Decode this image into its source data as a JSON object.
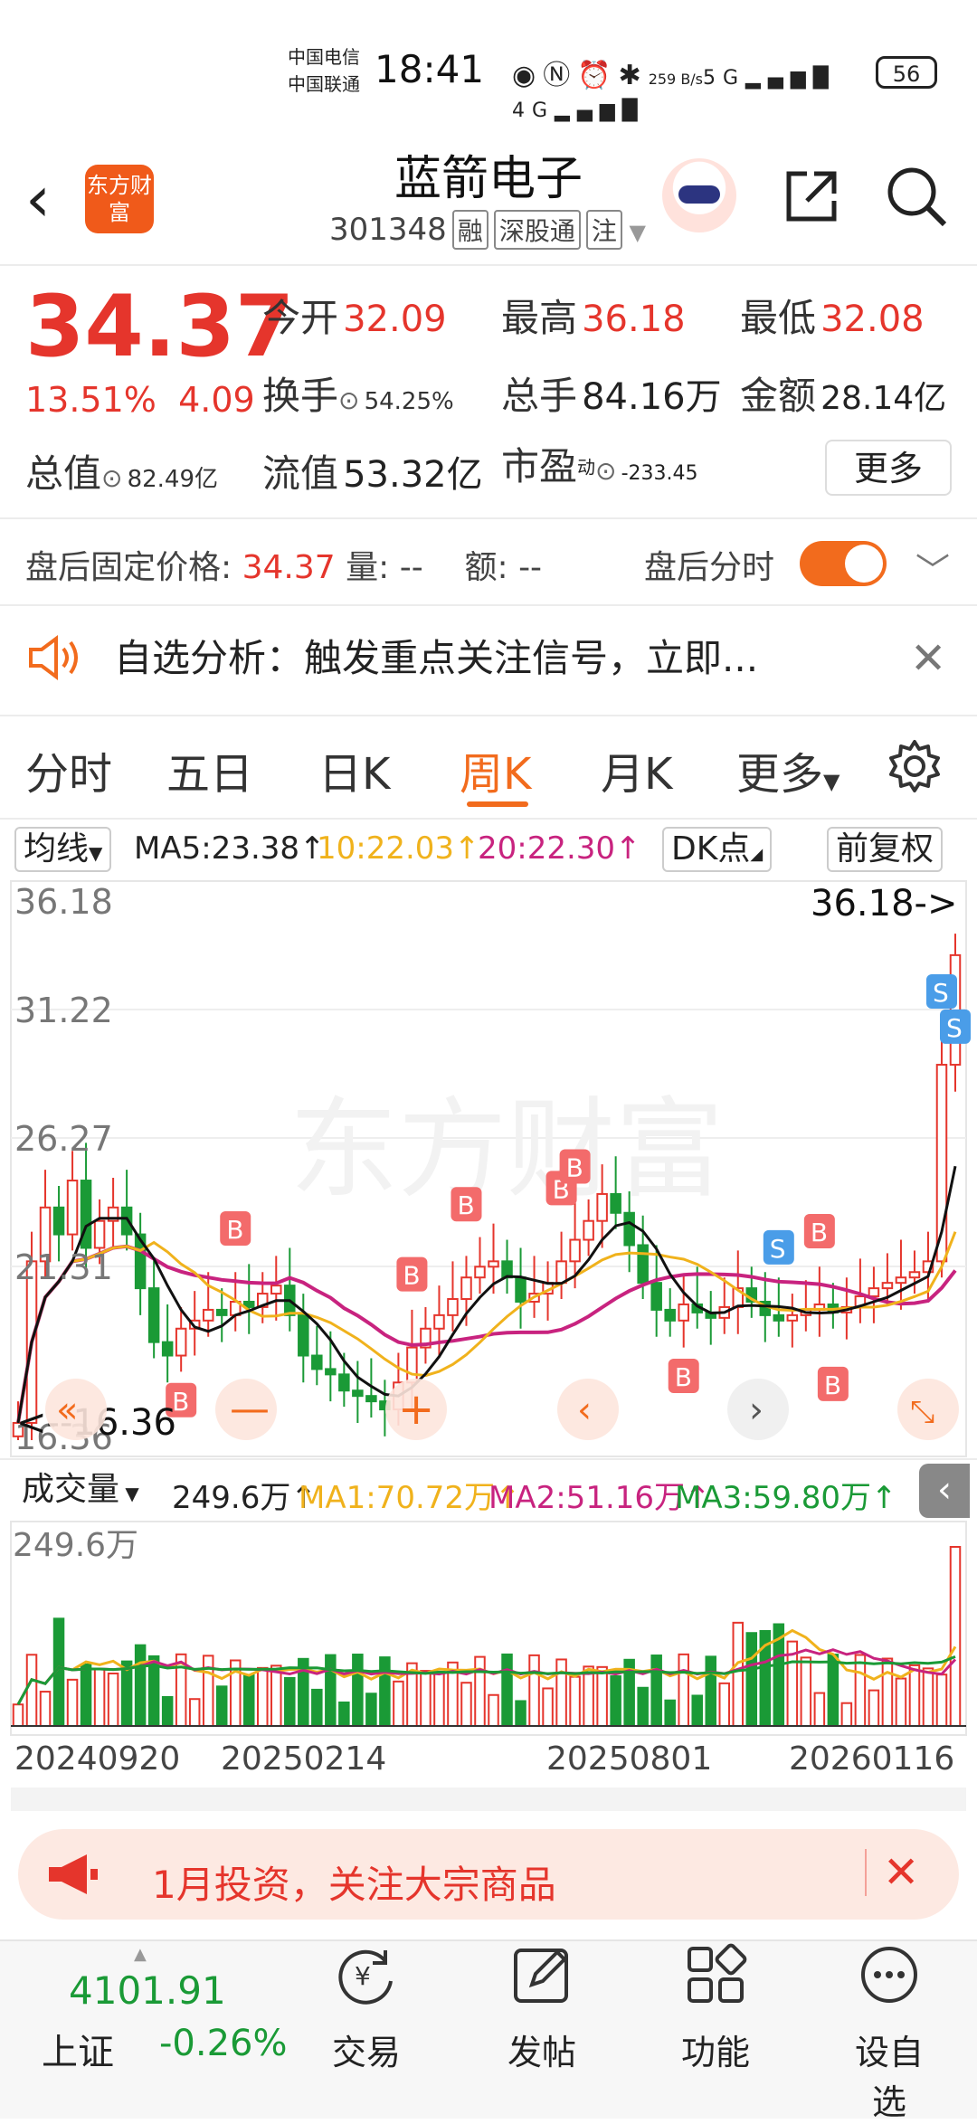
{
  "status_bar": {
    "carrier1": "中国电信",
    "carrier2": "中国联通",
    "time": "18:41",
    "net_speed": "259 B/s",
    "battery": "56"
  },
  "header": {
    "logo": "东方财富",
    "stock_name": "蓝箭电子",
    "stock_code": "301348",
    "tags": [
      "融",
      "深股通",
      "注"
    ]
  },
  "quote": {
    "price": "34.37",
    "change_pct": "13.51%",
    "change": "4.09",
    "open_label": "今开",
    "open": "32.09",
    "high_label": "最高",
    "high": "36.18",
    "low_label": "最低",
    "low": "32.08",
    "turnover_label": "换手",
    "turnover": "54.25%",
    "volume_label": "总手",
    "volume": "84.16万",
    "amount_label": "金额",
    "amount": "28.14亿",
    "mktcap_label": "总值",
    "mktcap": "82.49亿",
    "float_label": "流值",
    "float": "53.32亿",
    "pe_label": "市盈",
    "pe_sup": "动",
    "pe": "-233.45",
    "more": "更多"
  },
  "post_market": {
    "price_label": "盘后固定价格:",
    "price": "34.37",
    "vol_label": "量:",
    "vol": "--",
    "amt_label": "额:",
    "amt": "--",
    "toggle_label": "盘后分时"
  },
  "notice": {
    "text": "自选分析：触发重点关注信号，立即..."
  },
  "tabs": [
    "分时",
    "五日",
    "日K",
    "周K",
    "月K",
    "更多"
  ],
  "chart_toolbar": {
    "ma_select": "均线",
    "ma5": "MA5:23.38↑",
    "ma10": "10:22.03↑",
    "ma20": "20:22.30↑",
    "dk": "DK点",
    "adjust": "前复权"
  },
  "kline": {
    "y_labels": [
      "36.18",
      "31.22",
      "26.27",
      "21.31",
      "16.36"
    ],
    "max_marker": "36.18->",
    "min_marker": "<--16.36",
    "colors": {
      "up": "#e5352c",
      "down": "#1a9a36",
      "ma5": "#111111",
      "ma10": "#f0b21c",
      "ma20": "#c8237f"
    }
  },
  "volume_toolbar": {
    "select": "成交量",
    "vol": "249.6万↑",
    "ma1": "MA1:70.72万↑",
    "ma2": "MA2:51.16万↑",
    "ma3": "MA3:59.80万↑",
    "max": "249.6万"
  },
  "x_dates": [
    "20240920",
    "20250214",
    "20250801",
    "20260116"
  ],
  "banner": {
    "text": "1月投资，关注大宗商品"
  },
  "bottom_nav": {
    "index_value": "4101.91",
    "index_name": "上证",
    "index_change": "-0.26%",
    "items": [
      "交易",
      "发帖",
      "功能",
      "设自选"
    ]
  }
}
